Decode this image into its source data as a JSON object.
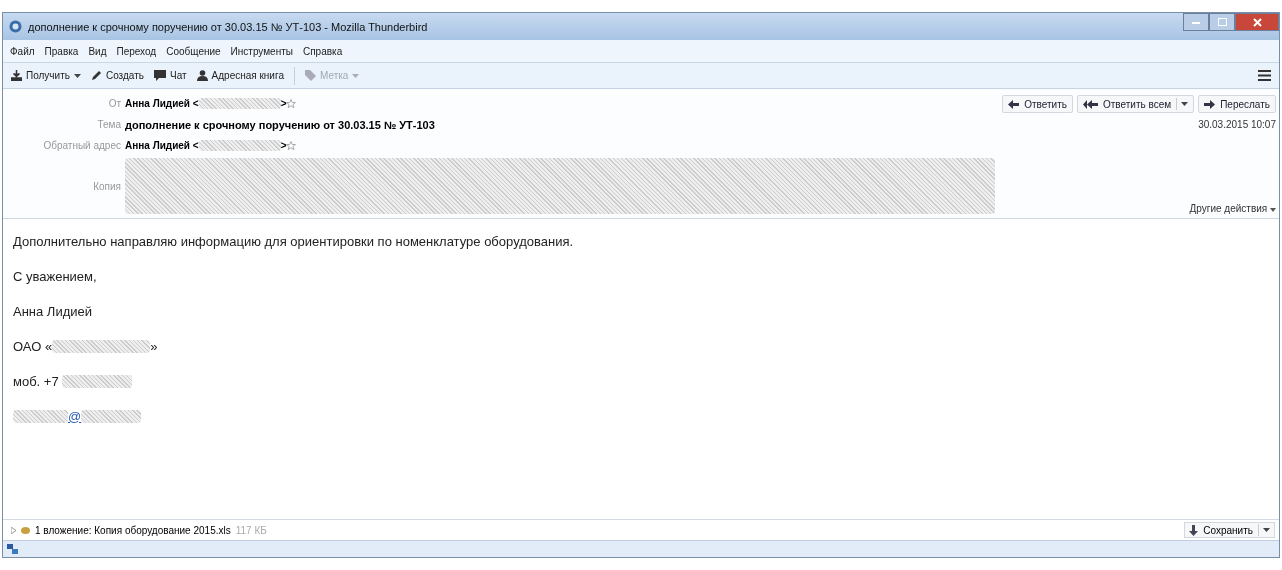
{
  "window": {
    "title": "дополнение к срочному поручению от 30.03.15 № УТ-103 - Mozilla Thunderbird"
  },
  "menu": [
    "Файл",
    "Правка",
    "Вид",
    "Переход",
    "Сообщение",
    "Инструменты",
    "Справка"
  ],
  "toolbar": [
    {
      "label": "Получить",
      "dropdown": true,
      "disabled": false
    },
    {
      "label": "Создать",
      "dropdown": false,
      "disabled": false
    },
    {
      "label": "Чат",
      "dropdown": false,
      "disabled": false
    },
    {
      "label": "Адресная книга",
      "dropdown": false,
      "disabled": false
    },
    {
      "label": "Метка",
      "dropdown": true,
      "disabled": true
    }
  ],
  "header": {
    "fields": [
      {
        "label": "От",
        "kind": "address",
        "value": "Анна Лидией <",
        "after": ">"
      },
      {
        "label": "Тема",
        "kind": "subject",
        "value": "дополнение к срочному поручению от 30.03.15 № УТ-103"
      },
      {
        "label": "Обратный адрес",
        "kind": "address",
        "value": "Анна Лидией <",
        "after": ">"
      },
      {
        "label": "Копия",
        "kind": "hidden"
      }
    ],
    "actions": [
      {
        "label": "Ответить",
        "dropdown": false
      },
      {
        "label": "Ответить всем",
        "dropdown": true
      },
      {
        "label": "Переслать",
        "dropdown": false
      }
    ],
    "date": "30.03.2015 10:07",
    "more": "Другие действия"
  },
  "body": [
    {
      "kind": "text",
      "text": "Дополнительно направляю информацию для ориентировки по номенклатуре оборудования."
    },
    {
      "kind": "text",
      "text": "С уважением,"
    },
    {
      "kind": "text",
      "text": "Анна Лидией"
    },
    {
      "kind": "company",
      "text": "ОАО «",
      "after": "»"
    },
    {
      "kind": "phone",
      "text": "моб. +7"
    },
    {
      "kind": "email",
      "text": "@"
    }
  ],
  "attachment": {
    "summary": "1 вложение: Копия оборудование 2015.xls",
    "size": "117 КБ",
    "save": "Сохранить"
  }
}
